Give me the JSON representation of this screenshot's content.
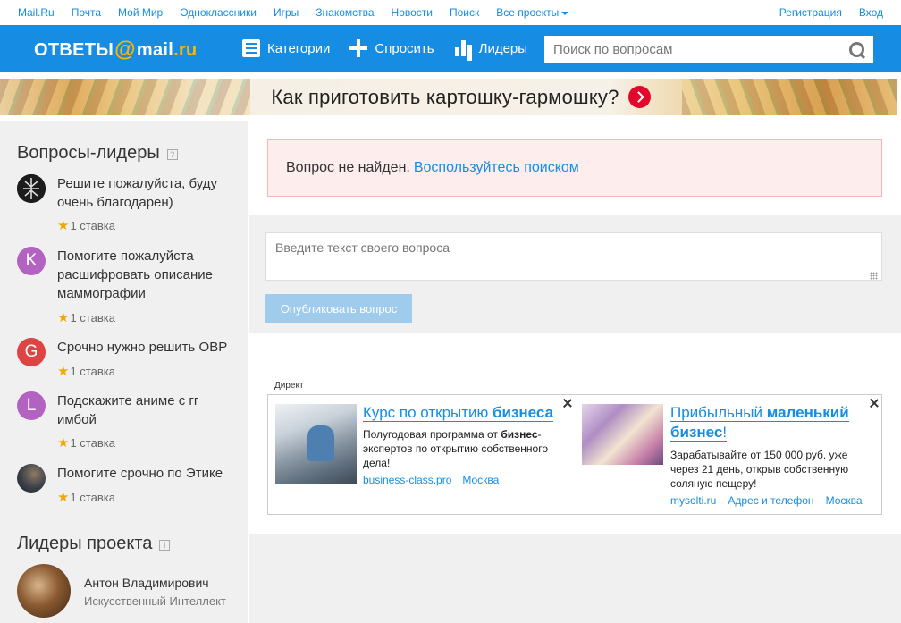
{
  "portal": {
    "links": [
      "Mail.Ru",
      "Почта",
      "Мой Мир",
      "Одноклассники",
      "Игры",
      "Знакомства",
      "Новости",
      "Поиск"
    ],
    "all_projects": "Все проекты",
    "register": "Регистрация",
    "login": "Вход"
  },
  "header": {
    "logo_text": "ОТВЕТЫ",
    "logo_at": "@",
    "logo_mail": "mail",
    "logo_ru": ".ru",
    "nav": {
      "categories": "Категории",
      "ask": "Спросить",
      "leaders": "Лидеры"
    },
    "search_placeholder": "Поиск по вопросам"
  },
  "promo": {
    "text": "Как приготовить картошку-гармошку?"
  },
  "sidebar": {
    "leaders_heading": "Вопросы-лидеры",
    "questions": [
      {
        "title": "Решите пожалуйста, буду очень благодарен)",
        "bet": "1 ставка",
        "avatar_letter": "",
        "avatar_color": "#1c1c1c"
      },
      {
        "title": "Помогите пожалуйста расшифровать описание маммографии",
        "bet": "1 ставка",
        "avatar_letter": "K",
        "avatar_color": "#b262c0"
      },
      {
        "title": "Срочно нужно решить ОВР",
        "bet": "1 ставка",
        "avatar_letter": "G",
        "avatar_color": "#dd4545"
      },
      {
        "title": "Подскажите аниме с гг имбой",
        "bet": "1 ставка",
        "avatar_letter": "L",
        "avatar_color": "#b262c0"
      },
      {
        "title": "Помогите срочно по Этике",
        "bet": "1 ставка",
        "avatar_letter": "",
        "avatar_color": "#2e3640"
      }
    ],
    "project_leaders_heading": "Лидеры проекта",
    "leader": {
      "name": "Антон Владимирович",
      "rank": "Искусственный Интеллект"
    }
  },
  "main": {
    "not_found_text": "Вопрос не найден.",
    "not_found_link": "Воспользуйтесь поиском",
    "ask_placeholder": "Введите текст своего вопроса",
    "publish_button": "Опубликовать вопрос",
    "direct_label": "Директ",
    "ads": [
      {
        "title_plain": "Курс по открытию ",
        "title_bold": "бизнеса",
        "text_1": "Полугодовая программа от ",
        "text_bold": "бизнес",
        "text_2": "-экспертов по открытию собственного дела!",
        "links": [
          "business-class.pro",
          "Москва"
        ]
      },
      {
        "title_plain": "Прибыльный ",
        "title_bold": "маленький бизнес",
        "title_end": "!",
        "text": "Зарабатывайте от 150 000 руб. уже через 21 день, открыв собственную соляную пещеру!",
        "links": [
          "mysolti.ru",
          "Адрес и телефон",
          "Москва"
        ]
      }
    ]
  },
  "colors": {
    "brand_blue": "#168de2",
    "accent_yellow": "#ffb400",
    "sidebar_bg": "#f0f0f0",
    "error_bg": "#fdeeed",
    "star": "#f0a800"
  }
}
